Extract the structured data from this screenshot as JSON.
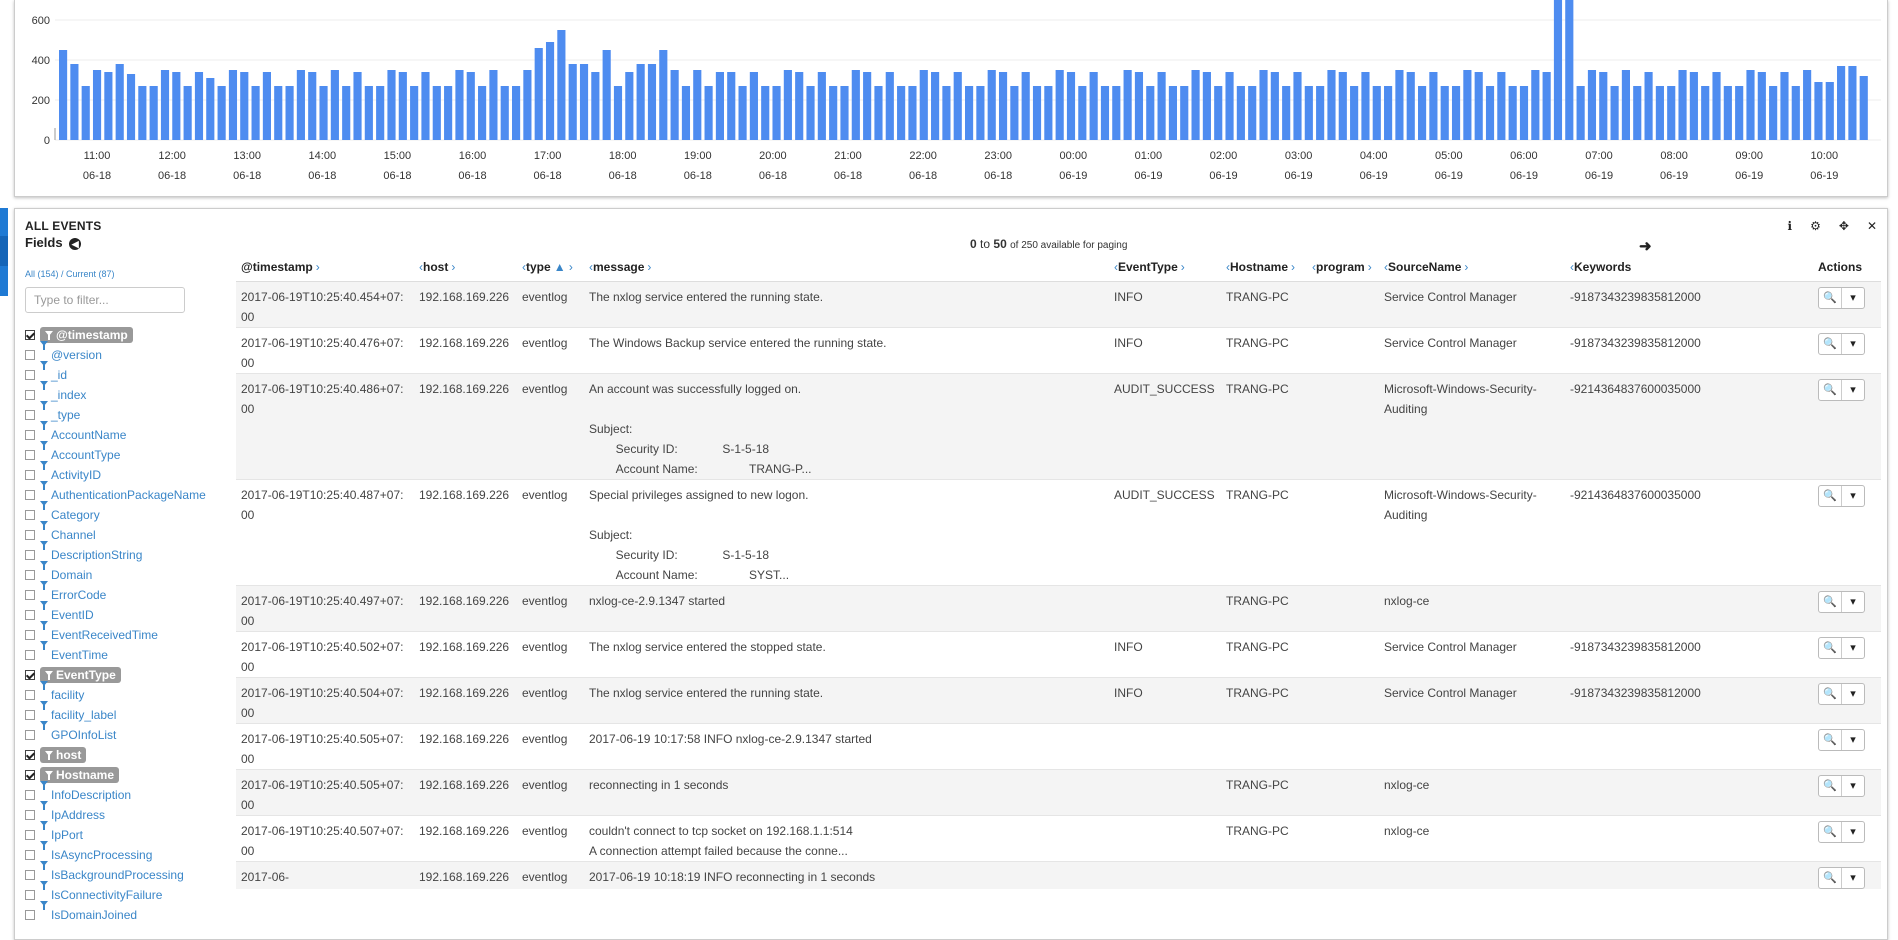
{
  "histogram": {
    "y_ticks": [
      "600",
      "400",
      "200",
      "0"
    ],
    "x_ticks": [
      {
        "time": "11:00",
        "date": "06-18"
      },
      {
        "time": "12:00",
        "date": "06-18"
      },
      {
        "time": "13:00",
        "date": "06-18"
      },
      {
        "time": "14:00",
        "date": "06-18"
      },
      {
        "time": "15:00",
        "date": "06-18"
      },
      {
        "time": "16:00",
        "date": "06-18"
      },
      {
        "time": "17:00",
        "date": "06-18"
      },
      {
        "time": "18:00",
        "date": "06-18"
      },
      {
        "time": "19:00",
        "date": "06-18"
      },
      {
        "time": "20:00",
        "date": "06-18"
      },
      {
        "time": "21:00",
        "date": "06-18"
      },
      {
        "time": "22:00",
        "date": "06-18"
      },
      {
        "time": "23:00",
        "date": "06-18"
      },
      {
        "time": "00:00",
        "date": "06-19"
      },
      {
        "time": "01:00",
        "date": "06-19"
      },
      {
        "time": "02:00",
        "date": "06-19"
      },
      {
        "time": "03:00",
        "date": "06-19"
      },
      {
        "time": "04:00",
        "date": "06-19"
      },
      {
        "time": "05:00",
        "date": "06-19"
      },
      {
        "time": "06:00",
        "date": "06-19"
      },
      {
        "time": "07:00",
        "date": "06-19"
      },
      {
        "time": "08:00",
        "date": "06-19"
      },
      {
        "time": "09:00",
        "date": "06-19"
      },
      {
        "time": "10:00",
        "date": "06-19"
      }
    ],
    "bar_color": "#4e8cf0"
  },
  "chart_data": {
    "type": "bar",
    "ylim": [
      0,
      700
    ],
    "values": [
      450,
      380,
      270,
      350,
      340,
      380,
      330,
      270,
      270,
      350,
      340,
      270,
      340,
      310,
      270,
      350,
      340,
      270,
      340,
      270,
      270,
      350,
      340,
      270,
      350,
      270,
      340,
      270,
      270,
      350,
      340,
      270,
      340,
      270,
      270,
      350,
      340,
      270,
      350,
      270,
      270,
      350,
      460,
      490,
      550,
      380,
      380,
      340,
      450,
      270,
      340,
      380,
      380,
      450,
      350,
      270,
      350,
      270,
      340,
      340,
      270,
      340,
      270,
      270,
      350,
      340,
      270,
      340,
      270,
      270,
      350,
      340,
      270,
      340,
      270,
      270,
      350,
      340,
      270,
      340,
      270,
      270,
      350,
      340,
      270,
      340,
      270,
      270,
      350,
      340,
      270,
      340,
      270,
      270,
      350,
      340,
      270,
      340,
      270,
      270,
      350,
      340,
      270,
      340,
      270,
      270,
      350,
      340,
      270,
      340,
      270,
      270,
      350,
      340,
      270,
      340,
      270,
      270,
      350,
      340,
      270,
      340,
      270,
      270,
      350,
      340,
      270,
      340,
      270,
      270,
      350,
      340,
      700,
      700,
      270,
      350,
      340,
      270,
      350,
      270,
      340,
      270,
      270,
      350,
      340,
      270,
      340,
      270,
      270,
      350,
      340,
      270,
      340,
      270,
      350,
      290,
      290,
      370,
      370,
      320
    ]
  },
  "panel": {
    "title": "ALL EVENTS",
    "fields_title": "Fields",
    "paging_from": "0",
    "paging_to": "to",
    "paging_end": "50",
    "paging_suffix": "of 250 available for paging",
    "icons": [
      "info-icon",
      "gear-icon",
      "move-icon",
      "close-icon"
    ],
    "icon_glyphs": [
      "ℹ",
      "⚙",
      "✥",
      "✕"
    ]
  },
  "fields": {
    "all_label": "All (154)",
    "sep": " / ",
    "current_label": "Current (87)",
    "filter_placeholder": "Type to filter...",
    "items": [
      {
        "name": "@timestamp",
        "checked": true
      },
      {
        "name": "@version",
        "checked": false
      },
      {
        "name": "_id",
        "checked": false
      },
      {
        "name": "_index",
        "checked": false
      },
      {
        "name": "_type",
        "checked": false
      },
      {
        "name": "AccountName",
        "checked": false
      },
      {
        "name": "AccountType",
        "checked": false
      },
      {
        "name": "ActivityID",
        "checked": false
      },
      {
        "name": "AuthenticationPackageName",
        "checked": false
      },
      {
        "name": "Category",
        "checked": false
      },
      {
        "name": "Channel",
        "checked": false
      },
      {
        "name": "DescriptionString",
        "checked": false
      },
      {
        "name": "Domain",
        "checked": false
      },
      {
        "name": "ErrorCode",
        "checked": false
      },
      {
        "name": "EventID",
        "checked": false
      },
      {
        "name": "EventReceivedTime",
        "checked": false
      },
      {
        "name": "EventTime",
        "checked": false
      },
      {
        "name": "EventType",
        "checked": true
      },
      {
        "name": "facility",
        "checked": false
      },
      {
        "name": "facility_label",
        "checked": false
      },
      {
        "name": "GPOInfoList",
        "checked": false
      },
      {
        "name": "host",
        "checked": true
      },
      {
        "name": "Hostname",
        "checked": true
      },
      {
        "name": "InfoDescription",
        "checked": false
      },
      {
        "name": "IpAddress",
        "checked": false
      },
      {
        "name": "IpPort",
        "checked": false
      },
      {
        "name": "IsAsyncProcessing",
        "checked": false
      },
      {
        "name": "IsBackgroundProcessing",
        "checked": false
      },
      {
        "name": "IsConnectivityFailure",
        "checked": false
      },
      {
        "name": "IsDomainJoined",
        "checked": false
      }
    ]
  },
  "table": {
    "columns": [
      {
        "label": "@timestamp",
        "pre": "",
        "post": "›"
      },
      {
        "label": "host",
        "pre": "‹",
        "post": "›"
      },
      {
        "label": "type",
        "pre": "‹",
        "post": "▲ ›"
      },
      {
        "label": "message",
        "pre": "‹",
        "post": "›"
      },
      {
        "label": "EventType",
        "pre": "‹",
        "post": "›"
      },
      {
        "label": "Hostname",
        "pre": "‹",
        "post": "›"
      },
      {
        "label": "program",
        "pre": "‹",
        "post": "›"
      },
      {
        "label": "SourceName",
        "pre": "‹",
        "post": "›"
      },
      {
        "label": "Keywords",
        "pre": "‹",
        "post": ""
      },
      {
        "label": "Actions",
        "pre": "",
        "post": ""
      }
    ],
    "action_icons": [
      "🔍",
      "▾"
    ],
    "rows": [
      {
        "timestamp": "2017-06-19T10:25:40.454+07:00",
        "host": "192.168.169.226",
        "type": "eventlog",
        "message": "The nxlog service entered the running state.",
        "eventtype": "INFO",
        "hostname": "TRANG-PC",
        "program": "",
        "sourcename": "Service Control Manager",
        "keywords": "-9187343239835812000"
      },
      {
        "timestamp": "2017-06-19T10:25:40.476+07:00",
        "host": "192.168.169.226",
        "type": "eventlog",
        "message": "The Windows Backup service entered the running state.",
        "eventtype": "INFO",
        "hostname": "TRANG-PC",
        "program": "",
        "sourcename": "Service Control Manager",
        "keywords": "-9187343239835812000"
      },
      {
        "timestamp": "2017-06-19T10:25:40.486+07:00",
        "host": "192.168.169.226",
        "type": "eventlog",
        "message": "An account was successfully logged on.\n\nSubject:\n\tSecurity ID:\t\tS-1-5-18\n\tAccount Name:\t\tTRANG-P...",
        "eventtype": "AUDIT_SUCCESS",
        "hostname": "TRANG-PC",
        "program": "",
        "sourcename": "Microsoft-Windows-Security-Auditing",
        "keywords": "-9214364837600035000"
      },
      {
        "timestamp": "2017-06-19T10:25:40.487+07:00",
        "host": "192.168.169.226",
        "type": "eventlog",
        "message": "Special privileges assigned to new logon.\n\nSubject:\n\tSecurity ID:\t\tS-1-5-18\n\tAccount Name:\t\tSYST...",
        "eventtype": "AUDIT_SUCCESS",
        "hostname": "TRANG-PC",
        "program": "",
        "sourcename": "Microsoft-Windows-Security-Auditing",
        "keywords": "-9214364837600035000"
      },
      {
        "timestamp": "2017-06-19T10:25:40.497+07:00",
        "host": "192.168.169.226",
        "type": "eventlog",
        "message": "nxlog-ce-2.9.1347 started",
        "eventtype": "",
        "hostname": "TRANG-PC",
        "program": "",
        "sourcename": "nxlog-ce",
        "keywords": ""
      },
      {
        "timestamp": "2017-06-19T10:25:40.502+07:00",
        "host": "192.168.169.226",
        "type": "eventlog",
        "message": "The nxlog service entered the stopped state.",
        "eventtype": "INFO",
        "hostname": "TRANG-PC",
        "program": "",
        "sourcename": "Service Control Manager",
        "keywords": "-9187343239835812000"
      },
      {
        "timestamp": "2017-06-19T10:25:40.504+07:00",
        "host": "192.168.169.226",
        "type": "eventlog",
        "message": "The nxlog service entered the running state.",
        "eventtype": "INFO",
        "hostname": "TRANG-PC",
        "program": "",
        "sourcename": "Service Control Manager",
        "keywords": "-9187343239835812000"
      },
      {
        "timestamp": "2017-06-19T10:25:40.505+07:00",
        "host": "192.168.169.226",
        "type": "eventlog",
        "message": "2017-06-19 10:17:58 INFO nxlog-ce-2.9.1347 started",
        "eventtype": "",
        "hostname": "",
        "program": "",
        "sourcename": "",
        "keywords": ""
      },
      {
        "timestamp": "2017-06-19T10:25:40.505+07:00",
        "host": "192.168.169.226",
        "type": "eventlog",
        "message": "reconnecting in 1 seconds",
        "eventtype": "",
        "hostname": "TRANG-PC",
        "program": "",
        "sourcename": "nxlog-ce",
        "keywords": ""
      },
      {
        "timestamp": "2017-06-19T10:25:40.507+07:00",
        "host": "192.168.169.226",
        "type": "eventlog",
        "message": "couldn't connect to tcp socket on 192.168.1.1:514\nA connection attempt failed because the conne...",
        "eventtype": "",
        "hostname": "TRANG-PC",
        "program": "",
        "sourcename": "nxlog-ce",
        "keywords": ""
      },
      {
        "timestamp": "2017-06-",
        "host": "192.168.169.226",
        "type": "eventlog",
        "message": "2017-06-19 10:18:19 INFO reconnecting in 1 seconds",
        "eventtype": "",
        "hostname": "",
        "program": "",
        "sourcename": "",
        "keywords": ""
      }
    ]
  }
}
